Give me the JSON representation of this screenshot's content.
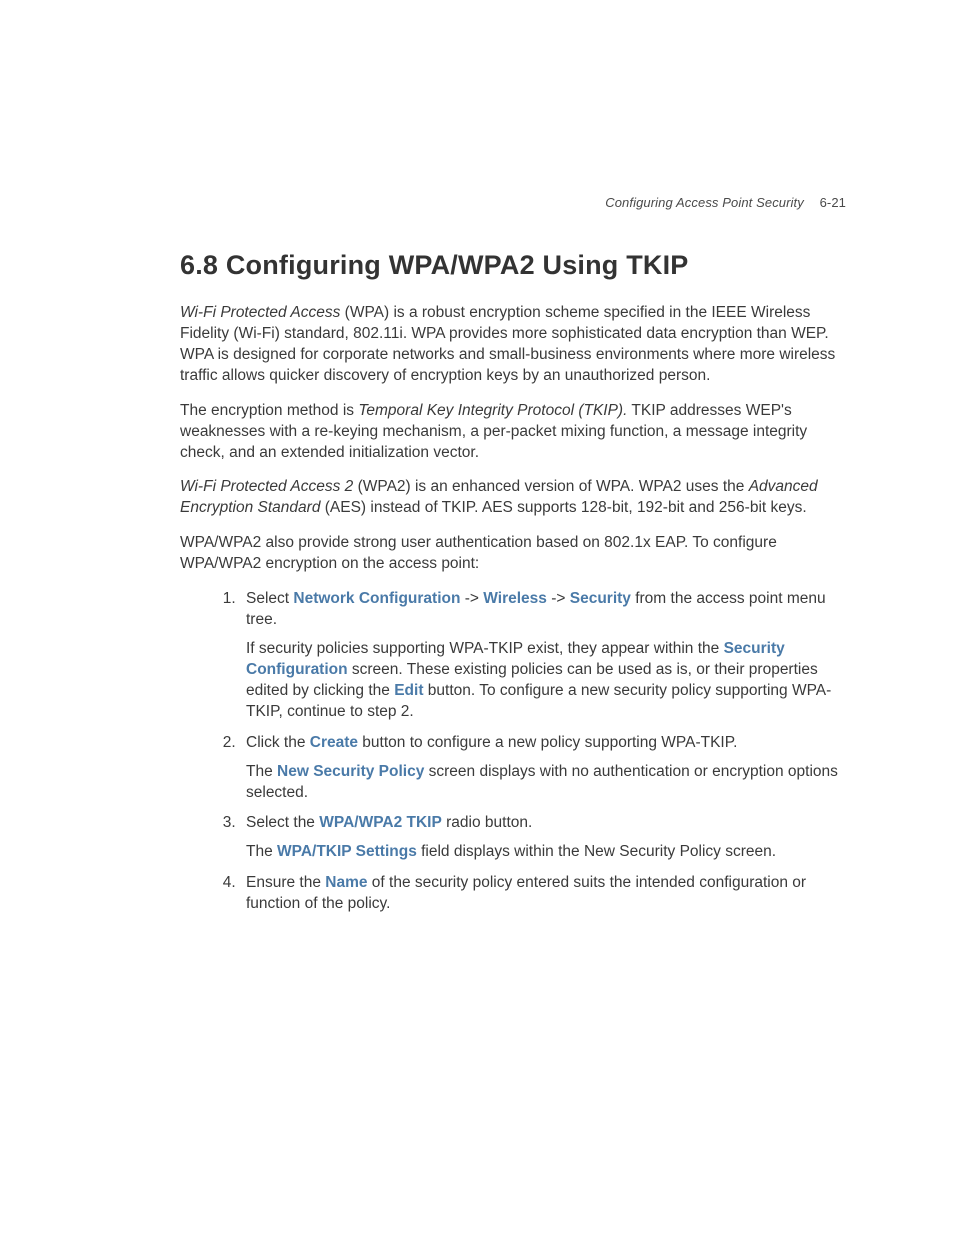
{
  "header": {
    "running_title": "Configuring Access Point Security",
    "page_number": "6-21"
  },
  "section": {
    "number": "6.8",
    "title": "Configuring WPA/WPA2 Using TKIP"
  },
  "paragraphs": {
    "p1_a": "Wi-Fi Protected Access",
    "p1_b": " (WPA) is a robust encryption scheme specified in the IEEE Wireless Fidelity (Wi-Fi) standard, 802.11i. WPA provides more sophisticated data encryption than WEP. WPA is designed for corporate networks and small-business environments where more wireless traffic allows quicker discovery of encryption keys by an unauthorized person.",
    "p2_a": "The encryption method is ",
    "p2_b": "Temporal Key Integrity Protocol (TKIP).",
    "p2_c": " TKIP addresses WEP's weaknesses with a re-keying mechanism, a per-packet mixing function, a message integrity check, and an extended initialization vector.",
    "p3_a": "Wi-Fi Protected Access 2",
    "p3_b": " (WPA2) is an enhanced version of WPA. WPA2 uses the ",
    "p3_c": "Advanced Encryption Standard",
    "p3_d": " (AES) instead of TKIP. AES supports 128-bit, 192-bit and 256-bit keys.",
    "p4": "WPA/WPA2 also provide strong user authentication based on 802.1x EAP. To configure WPA/WPA2 encryption on the access point:"
  },
  "steps": {
    "s1_a": "Select ",
    "s1_nc": "Network Configuration",
    "s1_arrow1": " -> ",
    "s1_w": "Wireless",
    "s1_arrow2": " -> ",
    "s1_sec": "Security",
    "s1_b": " from the access point menu tree.",
    "s1_p2_a": "If security policies supporting WPA-TKIP exist, they appear within the ",
    "s1_p2_sc": "Security Configuration",
    "s1_p2_b": " screen. These existing policies can be used as is, or their properties edited by clicking the ",
    "s1_p2_edit": "Edit",
    "s1_p2_c": " button. To configure a new security policy supporting WPA-TKIP, continue to step 2.",
    "s2_a": "Click the ",
    "s2_create": "Create",
    "s2_b": " button to configure a new policy supporting WPA-TKIP.",
    "s2_p2_a": "The ",
    "s2_p2_nsp": "New Security Policy",
    "s2_p2_b": " screen displays with no authentication or encryption options selected.",
    "s3_a": "Select the ",
    "s3_wpa": "WPA/WPA2 TKIP",
    "s3_b": " radio button.",
    "s3_p2_a": "The ",
    "s3_p2_wts": "WPA/TKIP Settings",
    "s3_p2_b": " field displays within the New Security Policy screen.",
    "s4_a": "Ensure the ",
    "s4_name": "Name",
    "s4_b": " of the security policy entered suits the intended configuration or function of the policy."
  }
}
